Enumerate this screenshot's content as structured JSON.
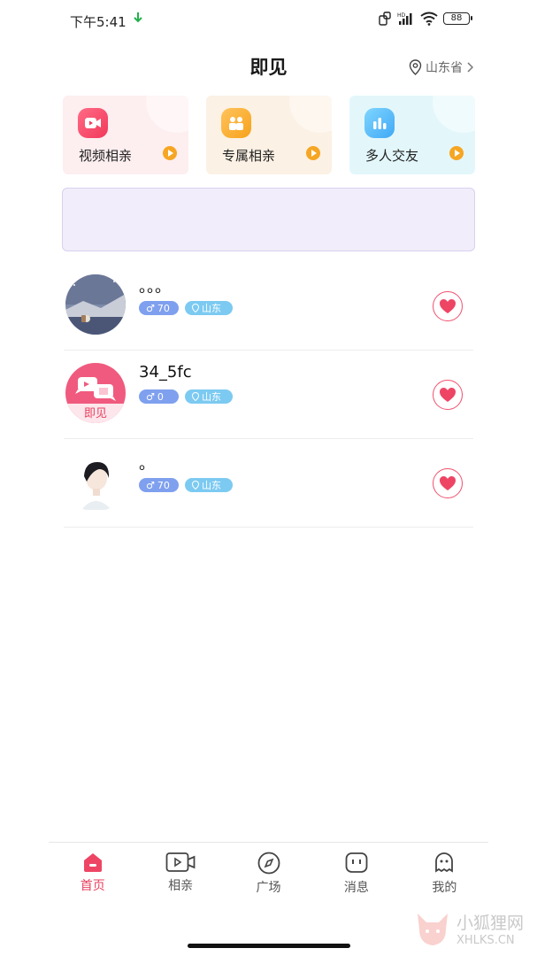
{
  "status_bar": {
    "time": "下午5:41",
    "network": "HD",
    "battery": "88"
  },
  "header": {
    "title": "即见",
    "location": "山东省"
  },
  "features": [
    {
      "label": "视频相亲",
      "icon": "video-camera-icon"
    },
    {
      "label": "专属相亲",
      "icon": "couple-icon"
    },
    {
      "label": "多人交友",
      "icon": "bar-chart-icon"
    }
  ],
  "users": [
    {
      "name": "。。。",
      "age": "70",
      "region": "山东"
    },
    {
      "name": "34_5fc",
      "age": "0",
      "region": "山东",
      "avatar_text": "即见"
    },
    {
      "name": "。",
      "age": "70",
      "region": "山东"
    }
  ],
  "tabs": [
    {
      "label": "首页",
      "active": true
    },
    {
      "label": "相亲"
    },
    {
      "label": "广场"
    },
    {
      "label": "消息"
    },
    {
      "label": "我的"
    }
  ],
  "watermark": {
    "line1": "小狐狸网",
    "line2": "XHLKS.CN"
  },
  "colors": {
    "accent": "#e8405e",
    "age_tag": "#7fa0ee",
    "region_tag": "#7ccaf2"
  }
}
